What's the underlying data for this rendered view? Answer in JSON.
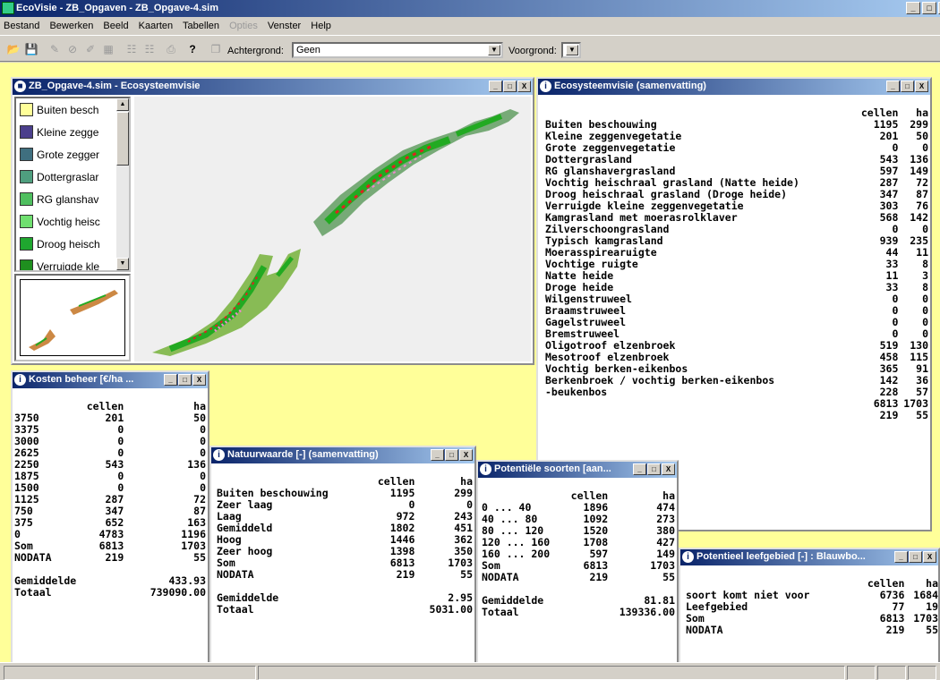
{
  "app": {
    "title": "EcoVisie - ZB_Opgaven - ZB_Opgave-4.sim"
  },
  "menu": [
    "Bestand",
    "Bewerken",
    "Beeld",
    "Kaarten",
    "Tabellen",
    "Opties",
    "Venster",
    "Help"
  ],
  "toolbar": {
    "background_label": "Achtergrond:",
    "background_value": "Geen",
    "foreground_label": "Voorgrond:"
  },
  "map_window": {
    "title": "ZB_Opgave-4.sim - Ecosysteemvisie",
    "legend": [
      {
        "label": "Buiten besch",
        "color": "#ffff99"
      },
      {
        "label": "Kleine zegge",
        "color": "#4b3f8c"
      },
      {
        "label": "Grote zegger",
        "color": "#3f6f7f"
      },
      {
        "label": "Dottergraslar",
        "color": "#4f9f7f"
      },
      {
        "label": "RG glanshav",
        "color": "#4fbf5f"
      },
      {
        "label": "Vochtig heisc",
        "color": "#6fdf6f"
      },
      {
        "label": "Droog heisch",
        "color": "#1fa72f"
      },
      {
        "label": "Verruigde kle",
        "color": "#1f8f1f"
      }
    ]
  },
  "eco_summary": {
    "title": "Ecosysteemvisie (samenvatting)",
    "headers": [
      "cellen",
      "ha"
    ],
    "rows": [
      {
        "label": "Buiten beschouwing",
        "cellen": "1195",
        "ha": "299"
      },
      {
        "label": "Kleine zeggenvegetatie",
        "cellen": "201",
        "ha": "50"
      },
      {
        "label": "Grote zeggenvegetatie",
        "cellen": "0",
        "ha": "0"
      },
      {
        "label": "Dottergrasland",
        "cellen": "543",
        "ha": "136"
      },
      {
        "label": "RG glanshavergrasland",
        "cellen": "597",
        "ha": "149"
      },
      {
        "label": "Vochtig heischraal grasland (Natte heide)",
        "cellen": "287",
        "ha": "72"
      },
      {
        "label": "Droog heischraal grasland (Droge heide)",
        "cellen": "347",
        "ha": "87"
      },
      {
        "label": "Verruigde kleine zeggenvegetatie",
        "cellen": "303",
        "ha": "76"
      },
      {
        "label": "Kamgrasland met moerasrolklaver",
        "cellen": "568",
        "ha": "142"
      },
      {
        "label": "Zilverschoongrasland",
        "cellen": "0",
        "ha": "0"
      },
      {
        "label": "Typisch kamgrasland",
        "cellen": "939",
        "ha": "235"
      },
      {
        "label": "Moerasspirearuigte",
        "cellen": "44",
        "ha": "11"
      },
      {
        "label": "Vochtige ruigte",
        "cellen": "33",
        "ha": "8"
      },
      {
        "label": "Natte heide",
        "cellen": "11",
        "ha": "3"
      },
      {
        "label": "Droge heide",
        "cellen": "33",
        "ha": "8"
      },
      {
        "label": "Wilgenstruweel",
        "cellen": "0",
        "ha": "0"
      },
      {
        "label": "Braamstruweel",
        "cellen": "0",
        "ha": "0"
      },
      {
        "label": "Gagelstruweel",
        "cellen": "0",
        "ha": "0"
      },
      {
        "label": "Bremstruweel",
        "cellen": "0",
        "ha": "0"
      },
      {
        "label": "Oligotroof elzenbroek",
        "cellen": "519",
        "ha": "130"
      },
      {
        "label": "Mesotroof elzenbroek",
        "cellen": "458",
        "ha": "115"
      },
      {
        "label": "Vochtig berken-eikenbos",
        "cellen": "365",
        "ha": "91"
      },
      {
        "label": "Berkenbroek / vochtig berken-eikenbos",
        "cellen": "142",
        "ha": "36"
      },
      {
        "label": "-beukenbos",
        "cellen": "228",
        "ha": "57"
      },
      {
        "label": "",
        "cellen": "6813",
        "ha": "1703"
      },
      {
        "label": "",
        "cellen": "219",
        "ha": "55"
      }
    ]
  },
  "kosten": {
    "title": "Kosten beheer [€/ha ...",
    "headers": [
      "cellen",
      "ha"
    ],
    "rows": [
      {
        "label": "3750",
        "cellen": "201",
        "ha": "50"
      },
      {
        "label": "3375",
        "cellen": "0",
        "ha": "0"
      },
      {
        "label": "3000",
        "cellen": "0",
        "ha": "0"
      },
      {
        "label": "2625",
        "cellen": "0",
        "ha": "0"
      },
      {
        "label": "2250",
        "cellen": "543",
        "ha": "136"
      },
      {
        "label": "1875",
        "cellen": "0",
        "ha": "0"
      },
      {
        "label": "1500",
        "cellen": "0",
        "ha": "0"
      },
      {
        "label": "1125",
        "cellen": "287",
        "ha": "72"
      },
      {
        "label": "750",
        "cellen": "347",
        "ha": "87"
      },
      {
        "label": "375",
        "cellen": "652",
        "ha": "163"
      },
      {
        "label": "0",
        "cellen": "4783",
        "ha": "1196"
      },
      {
        "label": "Som",
        "cellen": "6813",
        "ha": "1703"
      },
      {
        "label": "NODATA",
        "cellen": "219",
        "ha": "55"
      }
    ],
    "gem_label": "Gemiddelde",
    "gem_value": "433.93",
    "tot_label": "Totaal",
    "tot_value": "739090.00"
  },
  "natuur": {
    "title": "Natuurwaarde [-] (samenvatting)",
    "headers": [
      "cellen",
      "ha"
    ],
    "rows": [
      {
        "label": "Buiten beschouwing",
        "cellen": "1195",
        "ha": "299"
      },
      {
        "label": "Zeer laag",
        "cellen": "0",
        "ha": "0"
      },
      {
        "label": "Laag",
        "cellen": "972",
        "ha": "243"
      },
      {
        "label": "Gemiddeld",
        "cellen": "1802",
        "ha": "451"
      },
      {
        "label": "Hoog",
        "cellen": "1446",
        "ha": "362"
      },
      {
        "label": "Zeer hoog",
        "cellen": "1398",
        "ha": "350"
      },
      {
        "label": "Som",
        "cellen": "6813",
        "ha": "1703"
      },
      {
        "label": "NODATA",
        "cellen": "219",
        "ha": "55"
      }
    ],
    "gem_label": "Gemiddelde",
    "gem_value": "2.95",
    "tot_label": "Totaal",
    "tot_value": "5031.00"
  },
  "soorten": {
    "title": "Potentiële soorten [aan...",
    "headers": [
      "cellen",
      "ha"
    ],
    "rows": [
      {
        "label": "0 ... 40",
        "cellen": "1896",
        "ha": "474"
      },
      {
        "label": "40 ... 80",
        "cellen": "1092",
        "ha": "273"
      },
      {
        "label": "80 ... 120",
        "cellen": "1520",
        "ha": "380"
      },
      {
        "label": "120 ... 160",
        "cellen": "1708",
        "ha": "427"
      },
      {
        "label": "160 ... 200",
        "cellen": "597",
        "ha": "149"
      },
      {
        "label": "Som",
        "cellen": "6813",
        "ha": "1703"
      },
      {
        "label": "NODATA",
        "cellen": "219",
        "ha": "55"
      }
    ],
    "gem_label": "Gemiddelde",
    "gem_value": "81.81",
    "tot_label": "Totaal",
    "tot_value": "139336.00"
  },
  "leefgebied": {
    "title": "Potentieel leefgebied [-] : Blauwbo...",
    "headers": [
      "cellen",
      "ha"
    ],
    "rows": [
      {
        "label": "soort komt niet voor",
        "cellen": "6736",
        "ha": "1684"
      },
      {
        "label": "Leefgebied",
        "cellen": "77",
        "ha": "19"
      },
      {
        "label": "Som",
        "cellen": "6813",
        "ha": "1703"
      },
      {
        "label": "NODATA",
        "cellen": "219",
        "ha": "55"
      }
    ]
  }
}
